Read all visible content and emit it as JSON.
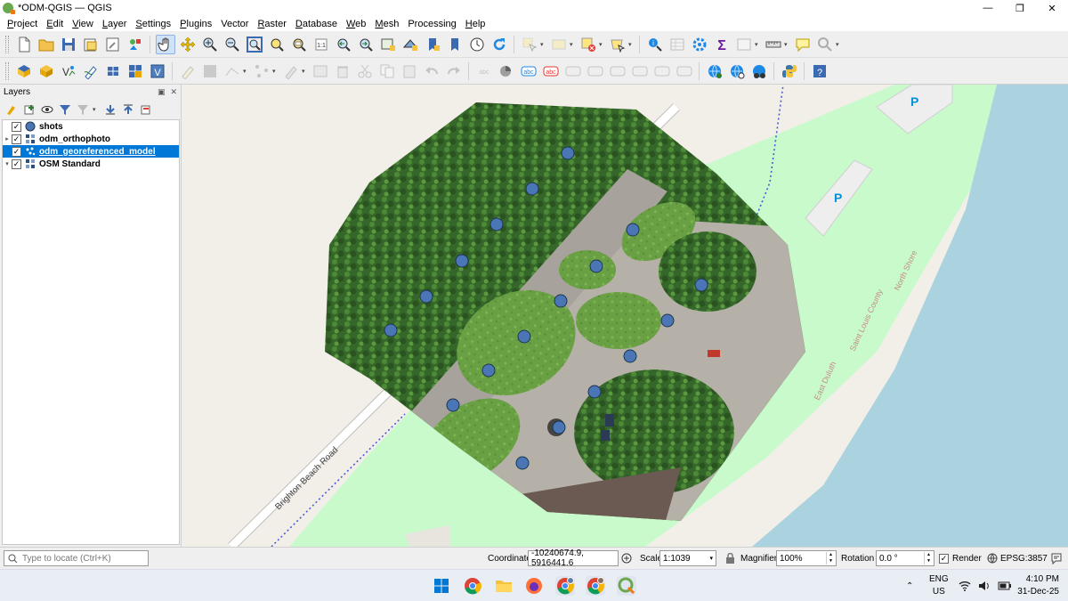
{
  "window": {
    "title": "*ODM-QGIS — QGIS",
    "minimize": "—",
    "restore": "❐",
    "close": "✕"
  },
  "menu": [
    {
      "label": "Project",
      "u": "P",
      "rest": "roject"
    },
    {
      "label": "Edit",
      "u": "E",
      "rest": "dit"
    },
    {
      "label": "View",
      "u": "V",
      "rest": "iew"
    },
    {
      "label": "Layer",
      "u": "L",
      "rest": "ayer"
    },
    {
      "label": "Settings",
      "u": "S",
      "rest": "ettings"
    },
    {
      "label": "Plugins",
      "u": "P",
      "rest": "lugins"
    },
    {
      "label": "Vector",
      "u": "",
      "rest": "Vector"
    },
    {
      "label": "Raster",
      "u": "R",
      "rest": "aster"
    },
    {
      "label": "Database",
      "u": "D",
      "rest": "atabase"
    },
    {
      "label": "Web",
      "u": "W",
      "rest": "eb"
    },
    {
      "label": "Mesh",
      "u": "M",
      "rest": "esh"
    },
    {
      "label": "Processing",
      "u": "",
      "rest": "Processing"
    },
    {
      "label": "Help",
      "u": "H",
      "rest": "elp"
    }
  ],
  "layers_panel": {
    "title": "Layers",
    "float_icon": "▣",
    "close_icon": "✕"
  },
  "layers": [
    {
      "name": "shots",
      "checked": "✓",
      "expander": "",
      "icon": "point-layer-icon",
      "selected": false
    },
    {
      "name": "odm_orthophoto",
      "checked": "✓",
      "expander": "▸",
      "icon": "raster-layer-icon",
      "selected": false
    },
    {
      "name": "odm_georeferenced_model",
      "checked": "✓",
      "expander": "",
      "icon": "pointcloud-layer-icon",
      "selected": true
    },
    {
      "name": "OSM Standard",
      "checked": "✓",
      "expander": "▾",
      "icon": "raster-layer-icon",
      "selected": false
    }
  ],
  "map": {
    "road_label": "Brighton Beach Road",
    "shore_label": "North Shore",
    "county_label": "Saint Louis County",
    "city_label": "East Duluth",
    "parking_label": "P",
    "colors": {
      "background": "#f2efe9",
      "park": "#c8facc",
      "water": "#aad3df",
      "road": "#ffffff",
      "point_fill": "#4a76b5",
      "point_stroke": "#1f3550"
    }
  },
  "statusbar": {
    "locator_placeholder": "Type to locate (Ctrl+K)",
    "coordinate_label": "Coordinate",
    "coordinate_value": "-10240674.9, 5916441.6",
    "scale_label": "Scale",
    "scale_value": "1:1039",
    "magnifier_label": "Magnifier",
    "magnifier_value": "100%",
    "rotation_label": "Rotation",
    "rotation_value": "0.0 °",
    "render_label": "Render",
    "render_checked": "✓",
    "crs_label": "EPSG:3857"
  },
  "taskbar": {
    "lang_line1": "ENG",
    "lang_line2": "US",
    "time": "4:10 PM",
    "date": "31-Dec-25",
    "caret": "⌃"
  }
}
